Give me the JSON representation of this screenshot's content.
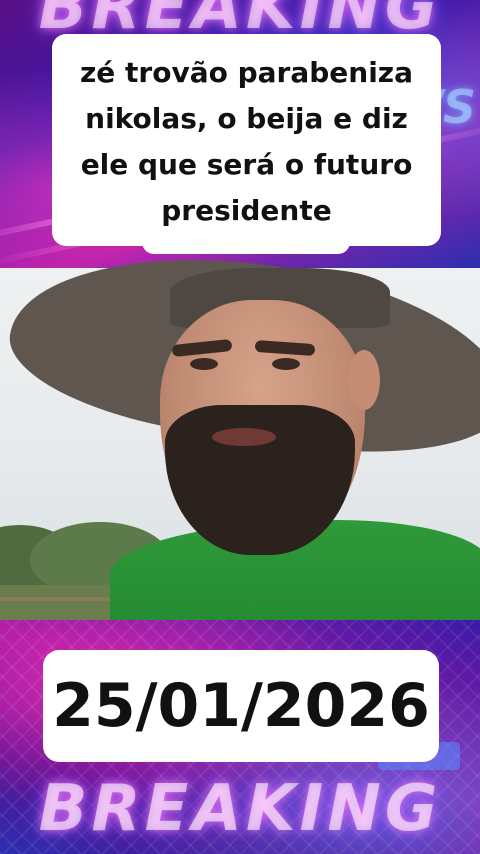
{
  "top_banner": {
    "word": "BREAKING",
    "side_mark": "/S"
  },
  "headline": {
    "text": "zé trovão parabeniza nikolas, o beija e diz ele que será o futuro presidente"
  },
  "video": {
    "subject": "man with hat and green shirt"
  },
  "date_card": {
    "text": "25/01/2026"
  },
  "bottom_banner": {
    "word": "BREAKING"
  },
  "colors": {
    "banner_magenta": "#b21da6",
    "banner_blue": "#2a2fb0",
    "card_bg": "#ffffff",
    "text": "#111111",
    "shirt_green": "#2f9a3a"
  }
}
